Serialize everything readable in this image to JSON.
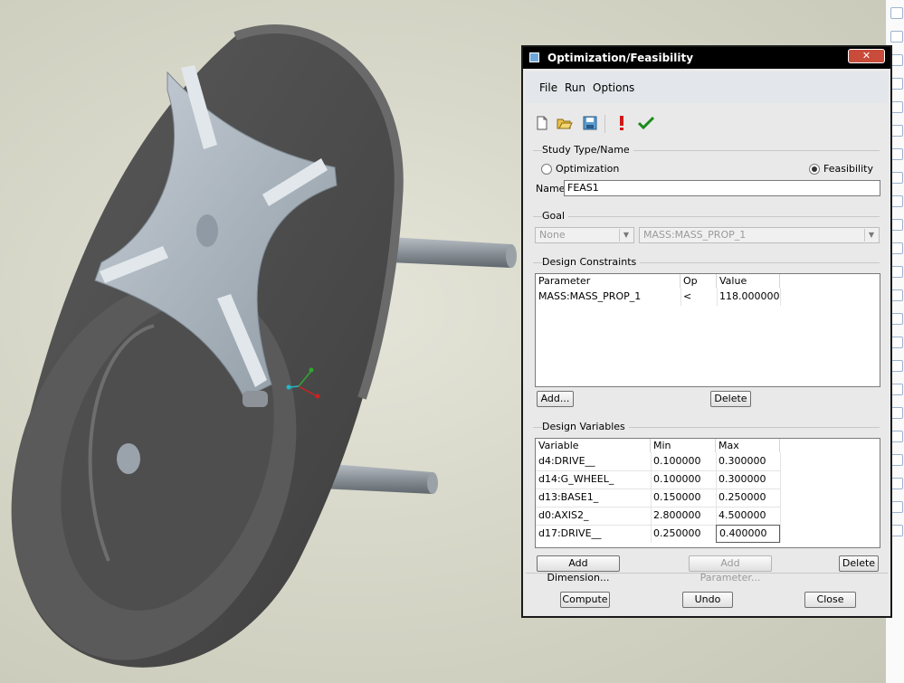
{
  "window": {
    "title": "Optimization/Feasibility",
    "close_label": "✕"
  },
  "menu": [
    "File",
    "Run",
    "Options"
  ],
  "toolbar": {
    "icons": [
      "new-icon",
      "open-icon",
      "save-icon",
      "exclamation-icon",
      "checkmark-icon"
    ],
    "colors": {
      "exclamation": "#d01818",
      "checkmark": "#1a8a1a"
    }
  },
  "study": {
    "section_title": "Study Type/Name",
    "option_optimization": "Optimization",
    "option_feasibility": "Feasibility",
    "selected": "Feasibility",
    "name_label": "Name",
    "name_value": "FEAS1"
  },
  "goal": {
    "section_title": "Goal",
    "type_value": "None",
    "parameter_value": "MASS:MASS_PROP_1"
  },
  "constraints": {
    "section_title": "Design Constraints",
    "headers": [
      "Parameter",
      "Op",
      "Value"
    ],
    "rows": [
      {
        "parameter": "MASS:MASS_PROP_1",
        "op": "<",
        "value": "118.000000"
      }
    ],
    "add_label": "Add...",
    "delete_label": "Delete"
  },
  "variables": {
    "section_title": "Design Variables",
    "headers": [
      "Variable",
      "Min",
      "Max"
    ],
    "rows": [
      {
        "variable": "d4:DRIVE__",
        "min": "0.100000",
        "max": "0.300000"
      },
      {
        "variable": "d14:G_WHEEL_",
        "min": "0.100000",
        "max": "0.300000"
      },
      {
        "variable": "d13:BASE1_",
        "min": "0.150000",
        "max": "0.250000"
      },
      {
        "variable": "d0:AXIS2_",
        "min": "2.800000",
        "max": "4.500000"
      },
      {
        "variable": "d17:DRIVE__",
        "min": "0.250000",
        "max": "0.400000"
      }
    ],
    "add_dimension_label": "Add Dimension...",
    "add_parameter_label": "Add Parameter...",
    "delete_label": "Delete"
  },
  "footer": {
    "compute_label": "Compute",
    "undo_label": "Undo",
    "close_label": "Close"
  }
}
